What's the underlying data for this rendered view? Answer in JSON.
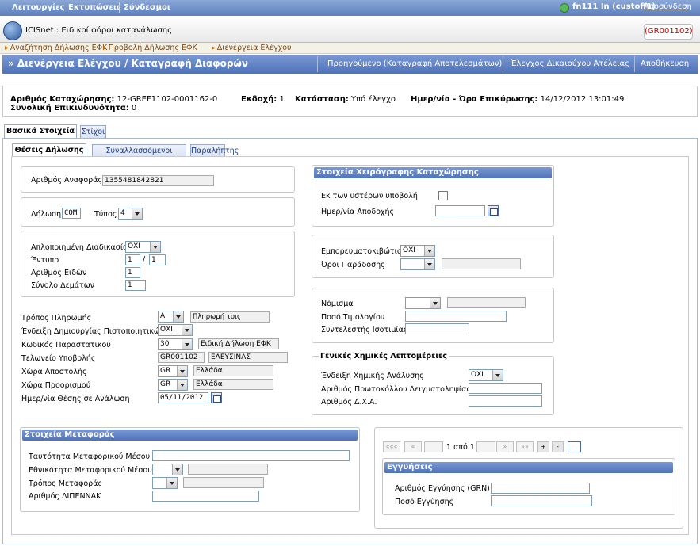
{
  "topmenu": {
    "functions": "Λειτουργίες",
    "prints": "Εκτυπώσεις",
    "links": "Σύνδεσμοι",
    "user": "fn111 In (custoff1)",
    "logout": "Αποσύνδεση"
  },
  "app": {
    "title": "ICISnet : Ειδικοί φόροι κατανάλωσης",
    "office_code": "(GR001102)"
  },
  "breadcrumbs": [
    "Αναζήτηση Δήλωσης ΕΦΚ",
    "Προβολή Δήλωσης ΕΦΚ",
    "Διενέργεια Ελέγχου"
  ],
  "navbar": {
    "title": "» Διενέργεια Ελέγχου / Καταγραφή Διαφορών",
    "previous": "Προηγούμενο (Καταγραφή Αποτελεσμάτων)",
    "check": "Έλεγχος Δικαιούχου Ατέλειας",
    "save": "Αποθήκευση"
  },
  "info": {
    "reg_no_label": "Αριθμός Καταχώρησης:",
    "reg_no": "12-GREF1102-0001162-0",
    "version_label": "Εκδοχή:",
    "version": "1",
    "status_label": "Κατάσταση:",
    "status": "Υπό έλεγχο",
    "confirm_label": "Ημερ/νία - Ώρα Επικύρωσης:",
    "confirm": "14/12/2012 13:01:49",
    "total_label": "Συνολική Επικινδυνότητα:",
    "total": "0"
  },
  "tabs_main": [
    "Βασικά Στοιχεία",
    "Στίχοι"
  ],
  "tabs_sub": [
    "Θέσεις Δήλωσης",
    "Συναλλασσόμενοι",
    "Παραλήπτης"
  ],
  "left": {
    "ref_label": "Αριθμός Αναφοράς",
    "ref_value": "1355481842821",
    "decl_label": "Δήλωση",
    "decl_value": "COM",
    "type_label": "Τύπος",
    "type_value": "4",
    "simplified_label": "Απλοποιημένη Διαδικασία",
    "simplified_value": "ΟΧΙ",
    "form_label": "Έντυπο",
    "form_a": "1",
    "form_sep": "/",
    "form_b": "1",
    "items_label": "Αριθμός Ειδών",
    "items_value": "1",
    "packages_label": "Σύνολο Δεμάτων",
    "packages_value": "1",
    "payment_label": "Τρόπος Πληρωμής",
    "payment_code": "A",
    "payment_desc": "Πληρωμή τοις μετρητο",
    "credit_label": "Ένδειξη Δημιουργίας Πιστοποιητικών",
    "credit_value": "ΟΧΙ",
    "doc_label": "Κωδικός Παραστατικού",
    "doc_code": "30",
    "doc_desc": "Ειδική Δήλωση ΕΦΚ",
    "office_label": "Τελωνείο Υποβολής",
    "office_code": "GR001102",
    "office_desc": "ΕΛΕΥΣΙΝΑΣ",
    "dispatch_label": "Χώρα Αποστολής",
    "dispatch_code": "GR",
    "dispatch_desc": "Ελλάδα",
    "dest_label": "Χώρα Προορισμού",
    "dest_code": "GR",
    "dest_desc": "Ελλάδα",
    "date_label": "Ημερ/νία Θέσης σε Ανάλωση",
    "date_value": "05/11/2012"
  },
  "right": {
    "manual_hdr": "Στοιχεία Χειρόγραφης Καταχώρησης",
    "late_label": "Εκ των υστέρων υποβολή",
    "accept_label": "Ημερ/νία Αποδοχής",
    "container_label": "Εμπορευματοκιβώτιο",
    "container_value": "ΟΧΙ",
    "delivery_label": "Όροι Παράδοσης",
    "currency_label": "Νόμισμα",
    "invoice_label": "Ποσό Τιμολογίου",
    "rate_label": "Συντελεστής Ισοτιμίας",
    "chem_hdr": "Γενικές Χημικές Λεπτομέρειες",
    "chem_label": "Ένδειξη Χημικής Ανάλυσης",
    "chem_value": "ΟΧΙ",
    "sample_label": "Αριθμός Πρωτοκόλλου Δειγματοληψίας",
    "dxa_label": "Αριθμός Δ.Χ.Α."
  },
  "transport": {
    "hdr": "Στοιχεία Μεταφοράς",
    "id_label": "Ταυτότητα Μεταφορικού Μέσου",
    "nat_label": "Εθνικότητα Μεταφορικού Μέσου",
    "mode_label": "Τρόπος Μεταφοράς",
    "dipennak_label": "Αριθμός ΔΙΠΕΝΝΑΚ"
  },
  "guarantees": {
    "pager": "1 από 1",
    "first": "«««",
    "prev": "«",
    "next": "»",
    "last": "»»",
    "plus": "+",
    "minus": "-",
    "hdr": "Εγγυήσεις",
    "grn_label": "Αριθμός Εγγύησης (GRN)",
    "amount_label": "Ποσό Εγγύησης"
  }
}
